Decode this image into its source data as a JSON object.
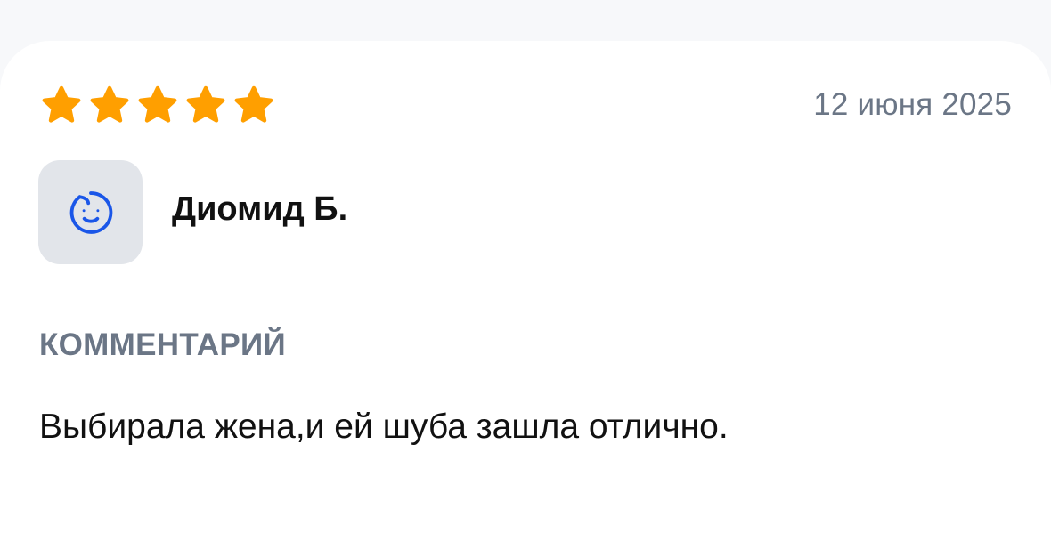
{
  "review": {
    "rating": 5,
    "max_rating": 5,
    "star_color": "#ff9f00",
    "date": "12 июня 2025",
    "author": {
      "name": "Диомид Б.",
      "avatar_icon": "smiley-face-icon",
      "avatar_color": "#1a56e8"
    },
    "comment_label": "КОММЕНТАРИЙ",
    "comment_text": "Выбирала жена,и ей шуба зашла отлично."
  }
}
